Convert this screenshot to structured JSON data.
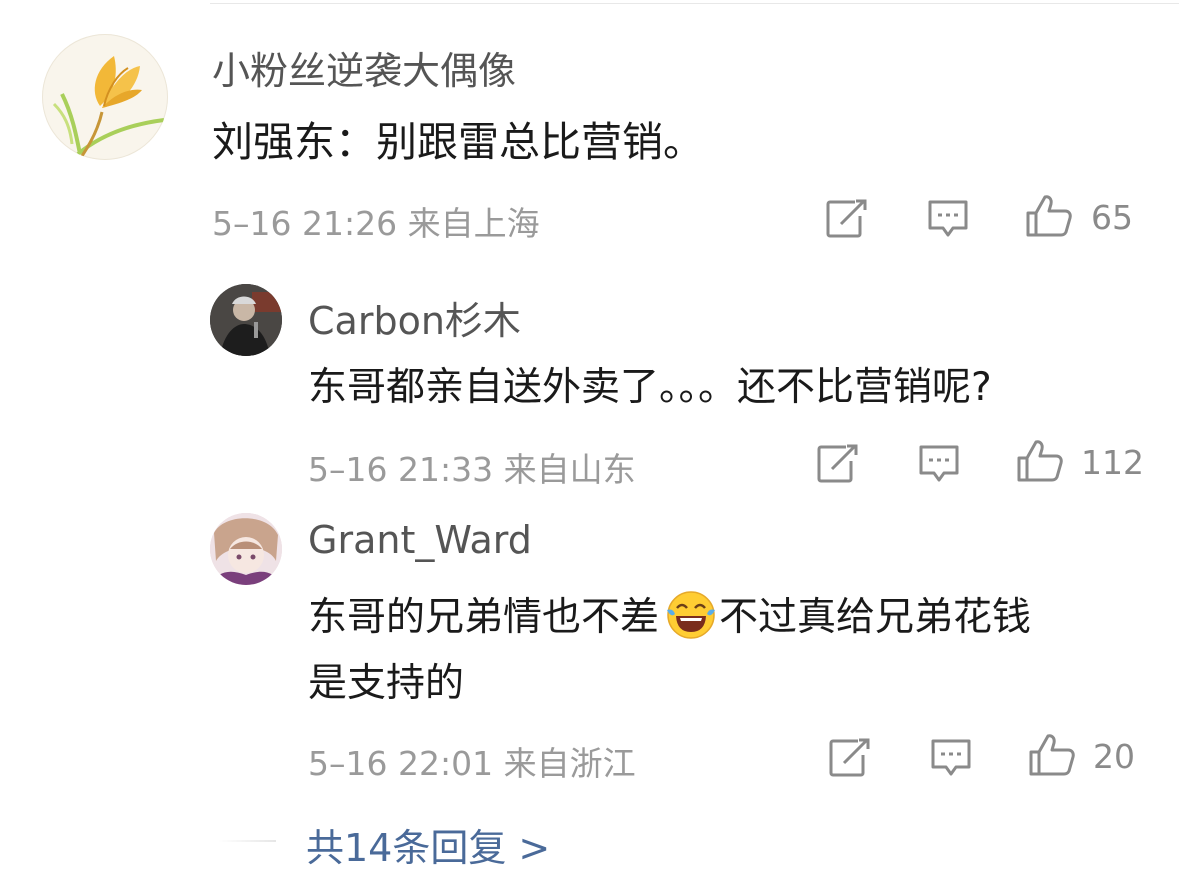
{
  "comment": {
    "author": "小粉丝逆袭大偶像",
    "text": "刘强东：别跟雷总比营销。",
    "meta": "5–16 21:26 来自上海",
    "likes": "65"
  },
  "replies": [
    {
      "author": "Carbon杉木",
      "text": "东哥都亲自送外卖了。。。还不比营销呢?",
      "meta": "5–16 21:33 来自山东",
      "likes": "112"
    },
    {
      "author": "Grant_Ward",
      "text_line1_a": "东哥的兄弟情也不差",
      "text_line1_b": "不过真给兄弟花钱",
      "text_line2": "是支持的",
      "meta": "5–16 22:01 来自浙江",
      "likes": "20"
    }
  ],
  "more_replies": "共14条回复 >",
  "colors": {
    "link": "#4a6a99",
    "meta": "#9a9a9a",
    "icon": "#8a8a8a"
  }
}
